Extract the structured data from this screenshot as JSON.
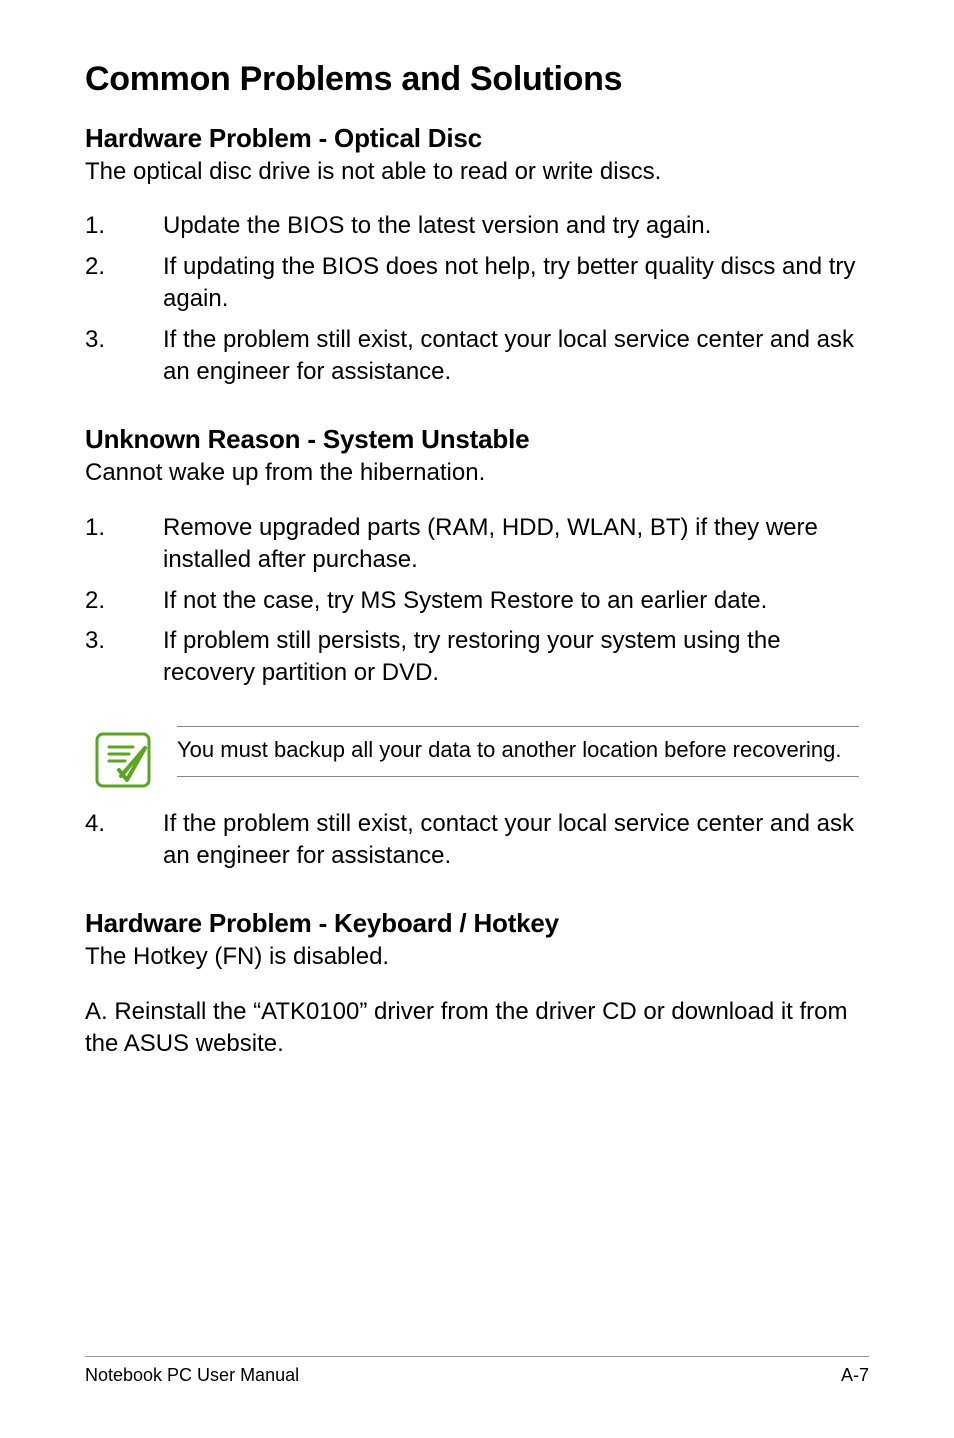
{
  "title": "Common Problems and Solutions",
  "sections": {
    "optical": {
      "heading": "Hardware Problem - Optical Disc",
      "intro": "The optical disc drive is not able to read or write discs.",
      "items": {
        "1": "Update the BIOS to the latest version and try again.",
        "2": "If updating the BIOS does not help, try better quality discs and try again.",
        "3": "If the problem still exist, contact your local service center and ask an engineer for assistance."
      }
    },
    "unstable": {
      "heading": "Unknown Reason - System Unstable",
      "intro": "Cannot wake up from the hibernation.",
      "items": {
        "1": "Remove upgraded parts (RAM, HDD, WLAN, BT) if they were installed after purchase.",
        "2": "If not the case, try MS System Restore to an earlier date.",
        "3": "If problem still persists, try restoring your system using the recovery partition or DVD.",
        "4": "If the problem still exist, contact your local service center and ask an engineer for assistance."
      },
      "note": "You must backup all your data to another location before recovering."
    },
    "keyboard": {
      "heading": "Hardware Problem - Keyboard / Hotkey",
      "intro": "The Hotkey (FN) is disabled.",
      "solution": "A. Reinstall the “ATK0100” driver from the driver CD or download it from the ASUS website."
    }
  },
  "footer": {
    "left": "Notebook PC User Manual",
    "right": "A-7"
  }
}
